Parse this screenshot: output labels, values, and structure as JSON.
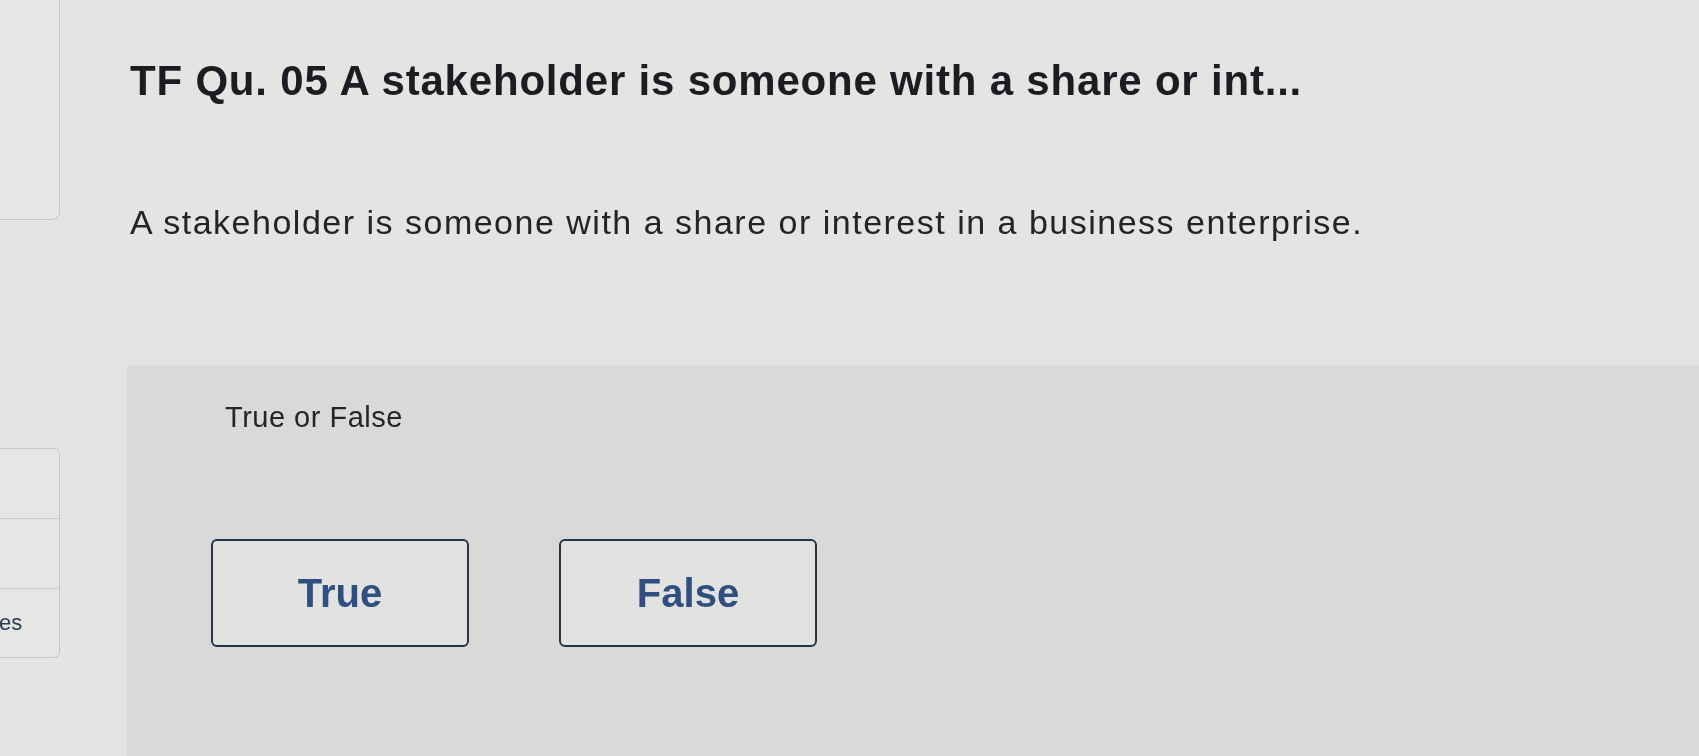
{
  "sidebar": {
    "item_label": "es"
  },
  "question": {
    "title": "TF Qu. 05 A stakeholder is someone with a share or int...",
    "text": "A stakeholder is someone with a share or interest in a business enterprise."
  },
  "answer_panel": {
    "prompt": "True or False",
    "options": [
      {
        "label": "True"
      },
      {
        "label": "False"
      }
    ]
  }
}
